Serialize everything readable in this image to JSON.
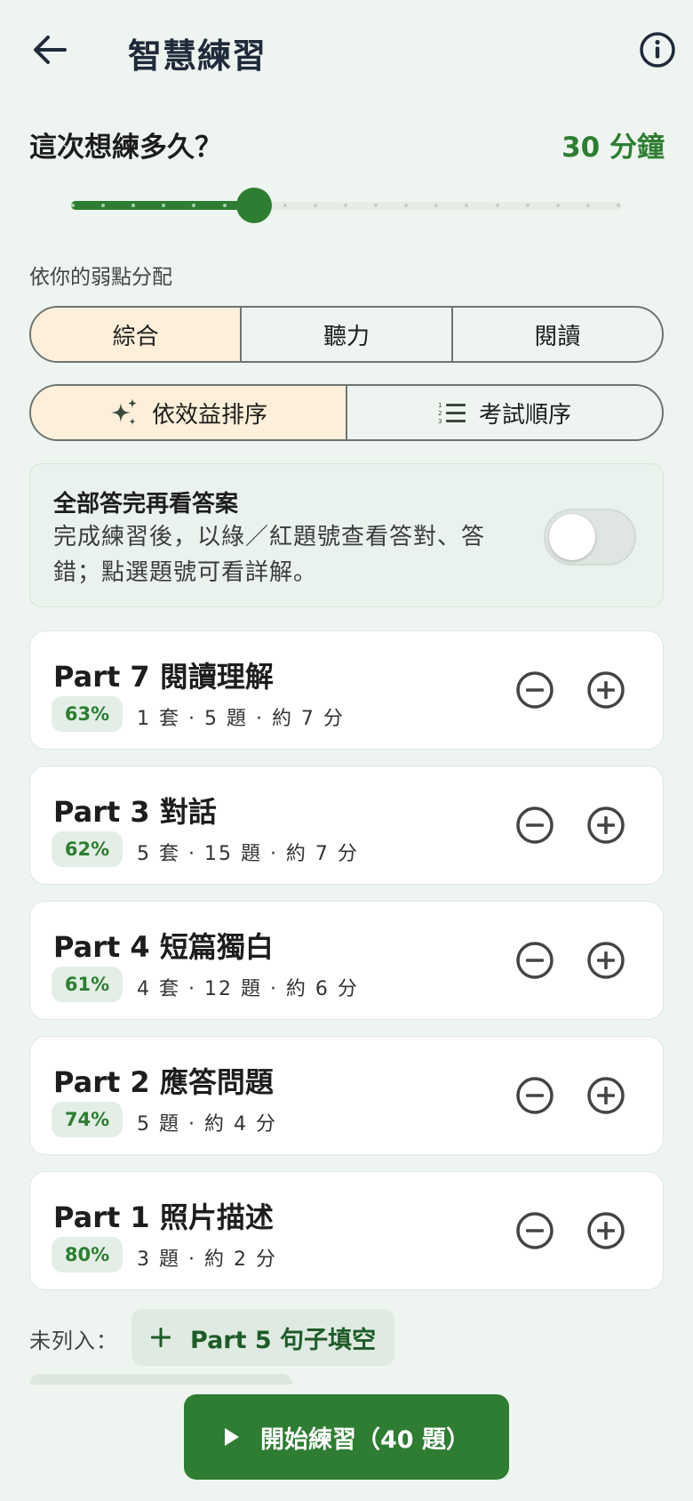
{
  "header": {
    "title": "智慧練習",
    "back_icon": "arrow-left-icon",
    "info_icon": "info-circle-icon"
  },
  "duration": {
    "label": "這次想練多久？",
    "value": "30 分鐘",
    "slider_fraction": 0.333,
    "accent": "#2e7d32"
  },
  "allocation": {
    "label": "依你的弱點分配",
    "skill_tabs": [
      "綜合",
      "聽力",
      "閱讀"
    ],
    "skill_selected": "綜合",
    "order_tabs": [
      "依效益排序",
      "考試順序"
    ],
    "order_icons": [
      "sparkle-icon",
      "numbered-list-icon"
    ],
    "order_selected": "依效益排序"
  },
  "review_toggle": {
    "title": "全部答完再看答案",
    "description": "完成練習後，以綠／紅題號查看答對、答錯；點選題號可看詳解。",
    "on": false
  },
  "parts": [
    {
      "name": "Part 7 閱讀理解",
      "score": "63%",
      "meta": "1 套 · 5 題 · 約 7 分"
    },
    {
      "name": "Part 3 對話",
      "score": "62%",
      "meta": "5 套 · 15 題 · 約 7 分"
    },
    {
      "name": "Part 4 短篇獨白",
      "score": "61%",
      "meta": "4 套 · 12 題 · 約 6 分"
    },
    {
      "name": "Part 2 應答問題",
      "score": "74%",
      "meta": "5 題 · 約 4 分"
    },
    {
      "name": "Part 1 照片描述",
      "score": "80%",
      "meta": "3 題 · 約 2 分"
    }
  ],
  "unlisted": {
    "label": "未列入：",
    "items": [
      "Part 5 句子填空"
    ]
  },
  "start_button": {
    "label": "開始練習（40 題）",
    "icon": "play-icon"
  },
  "colors": {
    "background": "#eef5f0",
    "primary": "#2e7d32",
    "selected_tab": "#fdefd9"
  }
}
